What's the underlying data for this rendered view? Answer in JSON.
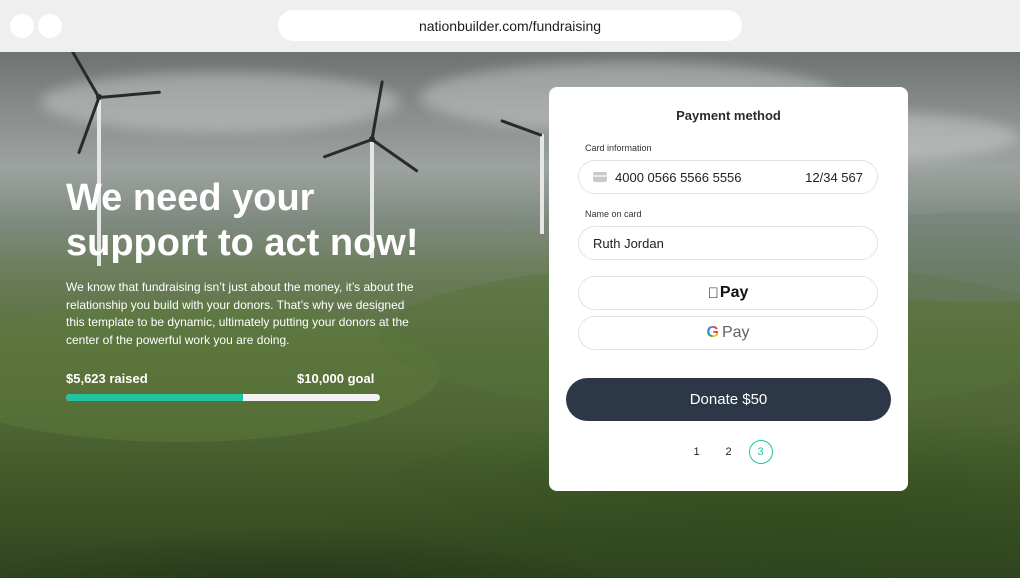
{
  "browser": {
    "url": "nationbuilder.com/fundraising"
  },
  "hero": {
    "headline_line1": "We need your",
    "headline_line2": "support to act now!",
    "body": "We know that fundraising isn’t just about the money, it’s about the relationship you build with your donors. That’s why we designed this template to be dynamic, ultimately putting your donors at the center of the powerful work you are doing.",
    "raised": "$5,623 raised",
    "goal": "$10,000 goal",
    "progress_fraction": 0.5623
  },
  "payment": {
    "title": "Payment method",
    "card_label": "Card information",
    "card_number": "4000 0566 5566 5556",
    "card_expiry": "12/34 567",
    "name_label": "Name on card",
    "name_value": "Ruth Jordan",
    "apple_pay": "Pay",
    "google_pay": "Pay",
    "google_g": "G",
    "donate_label": "Donate $50",
    "pages": [
      "1",
      "2",
      "3"
    ],
    "active_page": "3"
  },
  "colors": {
    "accent": "#22c3a0",
    "button": "#2c3847"
  },
  "icons": {
    "card": "credit-card-icon",
    "apple": "apple-icon",
    "google": "google-g-icon"
  }
}
